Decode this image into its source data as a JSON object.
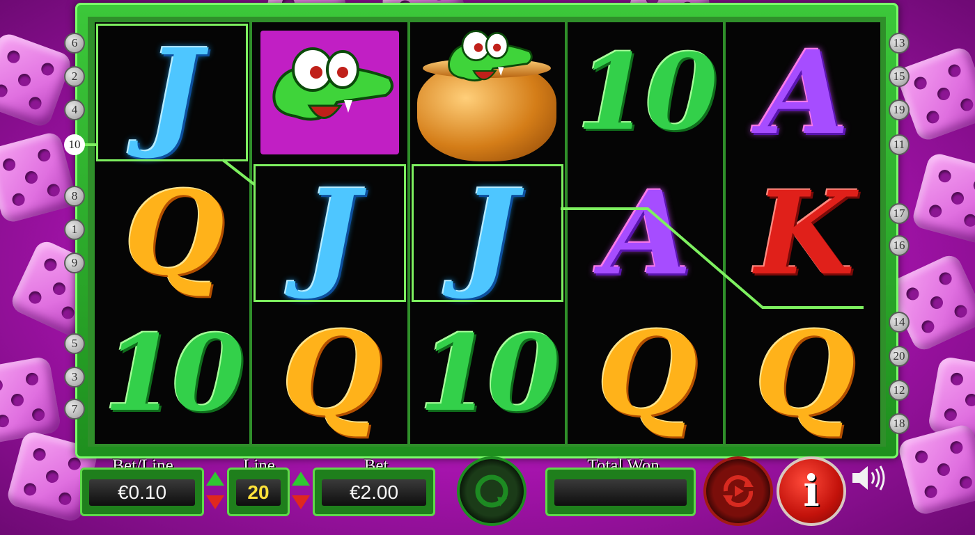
{
  "reels": [
    [
      "J",
      "Q",
      "10"
    ],
    [
      "croc",
      "J",
      "Q"
    ],
    [
      "croc-pot",
      "J",
      "10"
    ],
    [
      "10",
      "A",
      "Q"
    ],
    [
      "A",
      "K",
      "Q"
    ]
  ],
  "highlighted": [
    "0-0",
    "1-1",
    "2-1"
  ],
  "paylines_left": [
    "6",
    "2",
    "4",
    "10",
    "8",
    "1",
    "9",
    "5",
    "3",
    "7"
  ],
  "paylines_right": [
    "13",
    "15",
    "19",
    "11",
    "17",
    "16",
    "14",
    "20",
    "12",
    "18"
  ],
  "active_payline": "10",
  "panel": {
    "bet_line_label": "Bet/Line",
    "bet_line_value": "€0.10",
    "line_label": "Line",
    "line_value": "20",
    "bet_label": "Bet",
    "bet_value": "€2.00",
    "total_won_label": "Total Won",
    "total_won_value": "",
    "info_glyph": "i"
  },
  "icons": [
    "spin-icon",
    "autoplay-icon",
    "info-icon",
    "speaker-icon"
  ],
  "colors": {
    "frame": "#2fb02c",
    "payline": "#7ef060",
    "background": "#c026c6"
  }
}
